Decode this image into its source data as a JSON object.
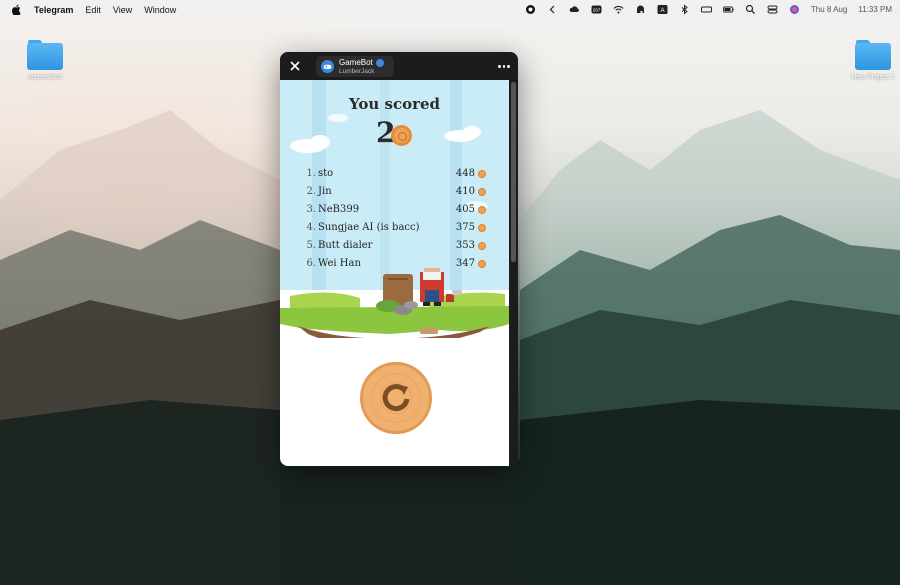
{
  "menubar": {
    "app": "Telegram",
    "items": [
      "Edit",
      "View",
      "Window"
    ],
    "date": "Thu 8 Aug",
    "time": "11:33 PM",
    "badge": "287"
  },
  "desktop": {
    "icons": [
      {
        "label": "screenshot",
        "icon": "folder-icon"
      },
      {
        "label": "New Project 1",
        "icon": "folder-icon"
      }
    ]
  },
  "window": {
    "bot_name": "GameBot",
    "bot_sub": "LumberJack"
  },
  "game": {
    "title": "You scored",
    "score": "2",
    "leaderboard": [
      {
        "rank": "1.",
        "name": "sto",
        "score": "448"
      },
      {
        "rank": "2.",
        "name": "Jin",
        "score": "410"
      },
      {
        "rank": "3.",
        "name": "NeB399",
        "score": "405"
      },
      {
        "rank": "4.",
        "name": "Sungjae AI (is bacc)",
        "score": "375"
      },
      {
        "rank": "5.",
        "name": "Butt dialer",
        "score": "353"
      },
      {
        "rank": "6.",
        "name": "Wei Han",
        "score": "347"
      }
    ],
    "replay_icon": "replay-icon"
  },
  "colors": {
    "accent": "#3b8ae0",
    "coin": "#f0a254",
    "sky": "#c9ecf7",
    "grass": "#8cc63f"
  }
}
